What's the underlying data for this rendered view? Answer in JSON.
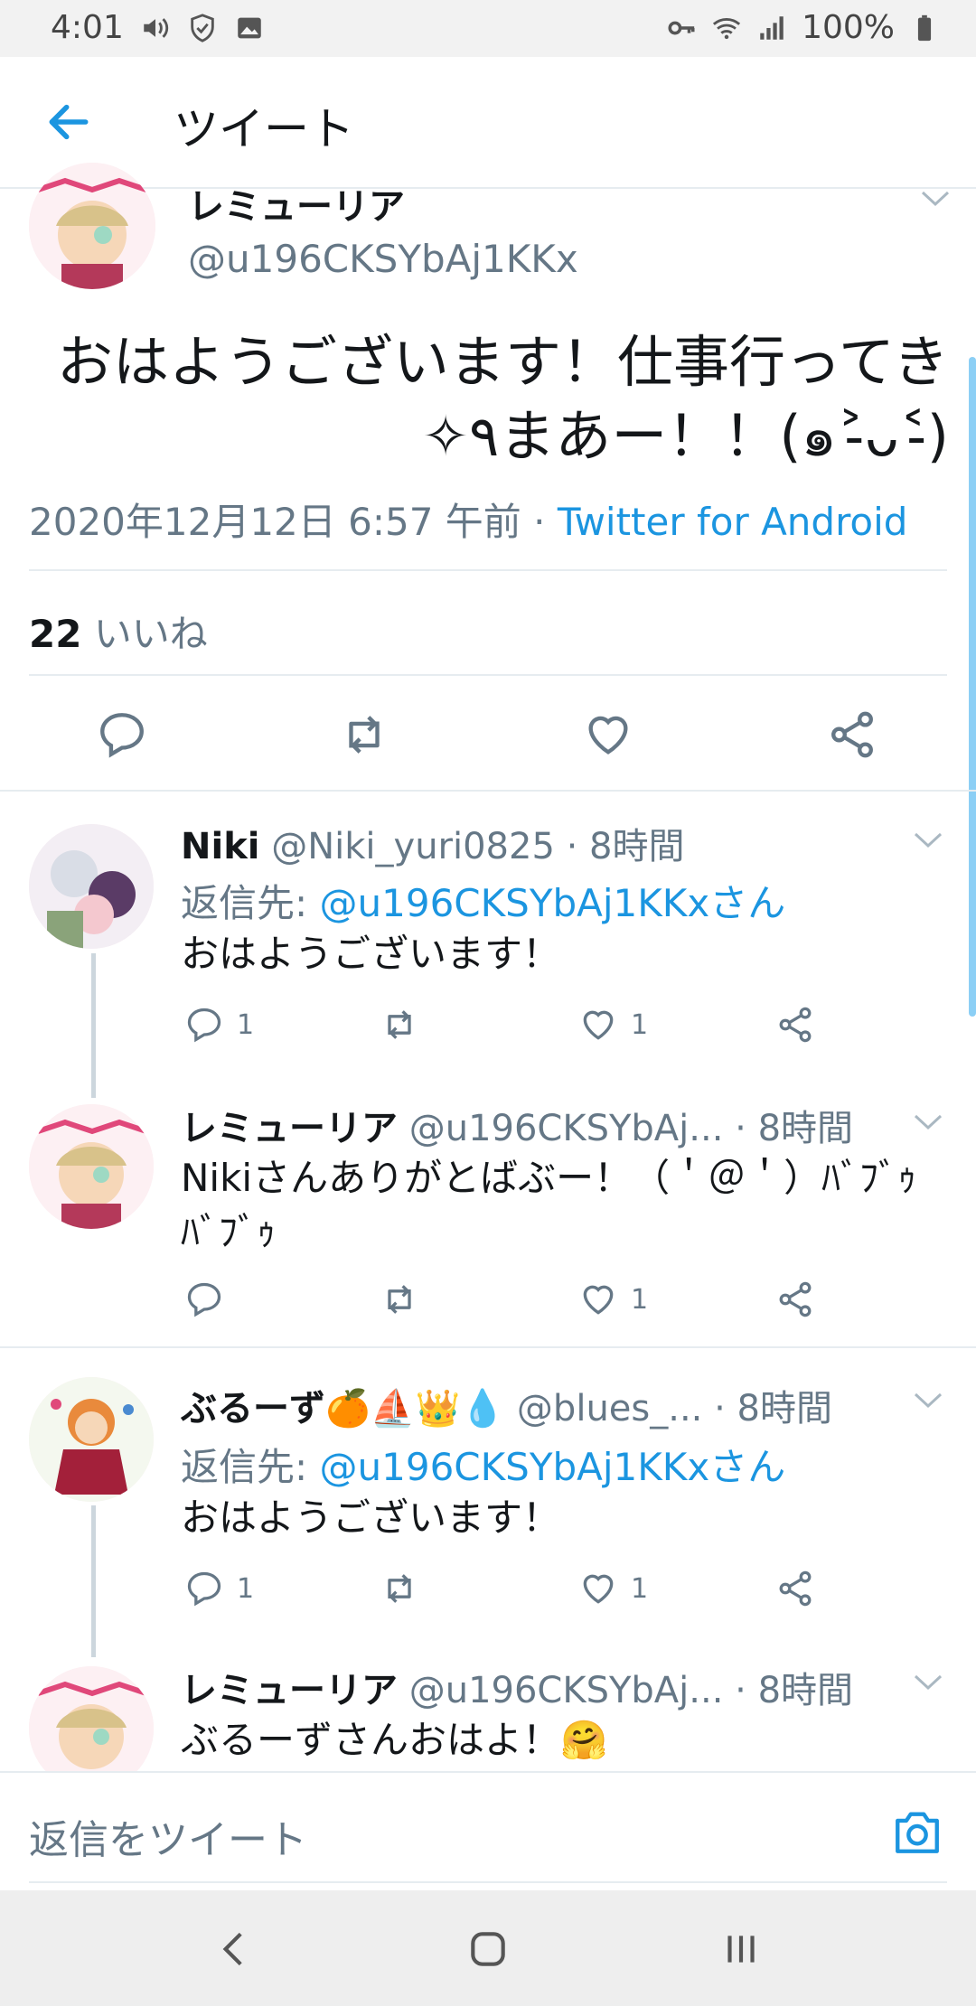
{
  "status": {
    "time": "4:01",
    "battery": "100%"
  },
  "header": {
    "title": "ツイート"
  },
  "main_tweet": {
    "display_name": "レミューリア",
    "handle": "@u196CKSYbAj1KKx",
    "text_line1": "おはようございます！仕事行ってき",
    "text_line2": "✧٩まあー！！(๑˃̵ᴗ˂̵)",
    "datetime": "2020年12月12日 6:57 午前",
    "separator": " · ",
    "source": "Twitter for Android",
    "like_count": "22",
    "like_label": " いいね"
  },
  "replies": [
    {
      "name": "Niki",
      "handle": " @Niki_yuri0825",
      "time": " · 8時間",
      "reply_prefix": "返信先: ",
      "reply_to": "@u196CKSYbAj1KKxさん",
      "text": "おはようございます！",
      "reply_count": "1",
      "like_count": "1"
    },
    {
      "name": "レミューリア",
      "handle": " @u196CKSYbAj...",
      "time": " · 8時間",
      "text": "Nikiさんありがとばぶー！（＇＠＇）ﾊﾞﾌﾞｩﾊﾞﾌﾞｩ",
      "like_count": "1"
    },
    {
      "name": "ぶるーず🍊⛵👑💧",
      "handle": " @blues_...",
      "time": " · 8時間",
      "reply_prefix": "返信先: ",
      "reply_to": "@u196CKSYbAj1KKxさん",
      "text": "おはようございます！",
      "reply_count": "1",
      "like_count": "1"
    },
    {
      "name": "レミューリア",
      "handle": " @u196CKSYbAj...",
      "time": " · 8時間",
      "text": "ぶるーずさんおはよ！🤗"
    }
  ],
  "composer": {
    "placeholder": "返信をツイート"
  },
  "colors": {
    "accent": "#1b95e0",
    "muted": "#657786",
    "divider": "#e6ecf0"
  }
}
